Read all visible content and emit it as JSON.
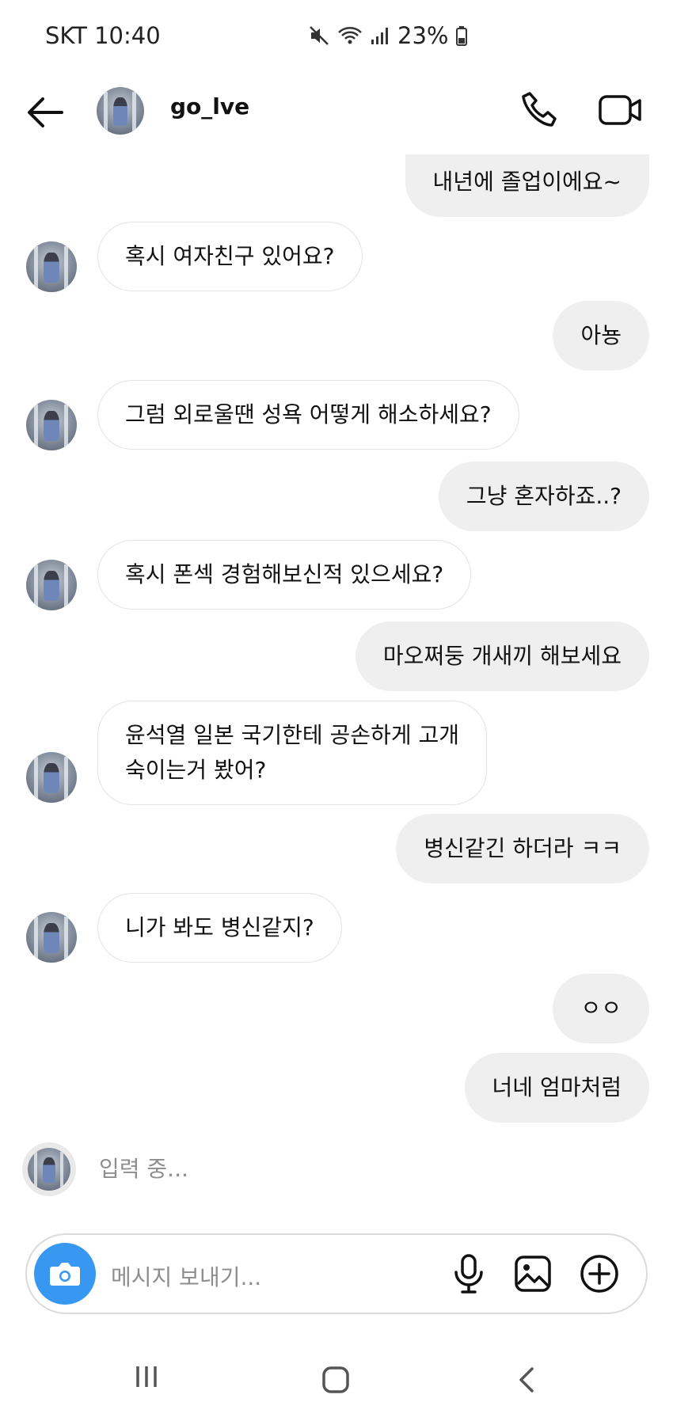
{
  "status_bar": {
    "carrier_time": "SKT 10:40",
    "battery": "23%"
  },
  "header": {
    "username": "go_lve"
  },
  "messages": [
    {
      "side": "out",
      "text": "내년에 졸업이에요~"
    },
    {
      "side": "in",
      "text": "혹시 여자친구 있어요?"
    },
    {
      "side": "out",
      "text": "아뇽"
    },
    {
      "side": "in",
      "text": "그럼 외로울땐 성욕 어떻게 해소하세요?"
    },
    {
      "side": "out",
      "text": "그냥 혼자하죠..?"
    },
    {
      "side": "in",
      "text": "혹시 폰섹 경험해보신적 있으세요?"
    },
    {
      "side": "out",
      "text": "마오쩌둥 개새끼 해보세요"
    },
    {
      "side": "in",
      "text": "윤석열 일본 국기한테 공손하게 고개\n숙이는거 봤어?"
    },
    {
      "side": "out",
      "text": "병신같긴 하더라 ㅋㅋ"
    },
    {
      "side": "in",
      "text": "니가 봐도 병신같지?"
    },
    {
      "side": "out",
      "text": "ㅇㅇ"
    },
    {
      "side": "out",
      "text": "너네 엄마처럼"
    }
  ],
  "typing_indicator": "입력 중...",
  "composer": {
    "placeholder": "메시지 보내기..."
  },
  "icons": {
    "back": "arrow-left-icon",
    "call": "phone-icon",
    "video": "video-camera-icon",
    "camera": "camera-icon",
    "mic": "microphone-icon",
    "gallery": "image-icon",
    "plus": "plus-circle-icon",
    "nav_menu": "recent-apps-icon",
    "nav_home": "home-icon",
    "nav_back": "chevron-left-icon"
  },
  "colors": {
    "accent": "#3897f0",
    "incoming_bubble": "#ffffff",
    "outgoing_bubble": "#efefef"
  }
}
